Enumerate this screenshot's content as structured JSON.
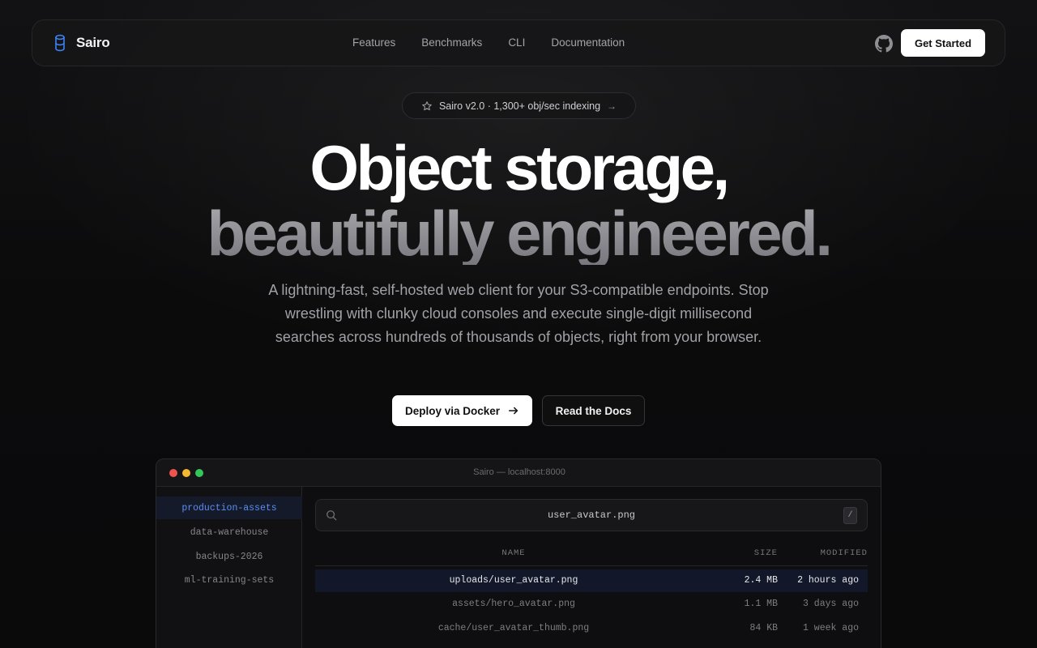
{
  "brand": {
    "name": "Sairo",
    "icon": "database-icon",
    "accent": "#3b82f6"
  },
  "nav": {
    "links": [
      "Features",
      "Benchmarks",
      "CLI",
      "Documentation"
    ],
    "github_icon": "github-icon",
    "cta": "Get Started"
  },
  "badge": {
    "icon": "star-icon",
    "text": "Sairo v2.0 · 1,300+ obj/sec indexing",
    "arrow": "→"
  },
  "hero": {
    "title_line1": "Object storage,",
    "title_line2": "beautifully engineered.",
    "subtitle": "A lightning-fast, self-hosted web client for your S3-compatible endpoints. Stop wrestling with clunky cloud consoles and execute single-digit millisecond searches across hundreds of thousands of objects, right from your browser.",
    "primary_button": "Deploy via Docker",
    "secondary_button": "Read the Docs"
  },
  "app": {
    "window_title": "Sairo — localhost:8000",
    "buckets": [
      {
        "name": "production-assets",
        "active": true
      },
      {
        "name": "data-warehouse",
        "active": false
      },
      {
        "name": "backups-2026",
        "active": false
      },
      {
        "name": "ml-training-sets",
        "active": false
      }
    ],
    "search": {
      "value": "user_avatar.png",
      "shortcut": "/"
    },
    "columns": {
      "name": "NAME",
      "size": "SIZE",
      "modified": "MODIFIED"
    },
    "rows": [
      {
        "name": "uploads/user_avatar.png",
        "size": "2.4 MB",
        "modified": "2 hours ago",
        "active": true
      },
      {
        "name": "assets/hero_avatar.png",
        "size": "1.1 MB",
        "modified": "3 days ago",
        "active": false
      },
      {
        "name": "cache/user_avatar_thumb.png",
        "size": "84 KB",
        "modified": "1 week ago",
        "active": false
      }
    ]
  }
}
